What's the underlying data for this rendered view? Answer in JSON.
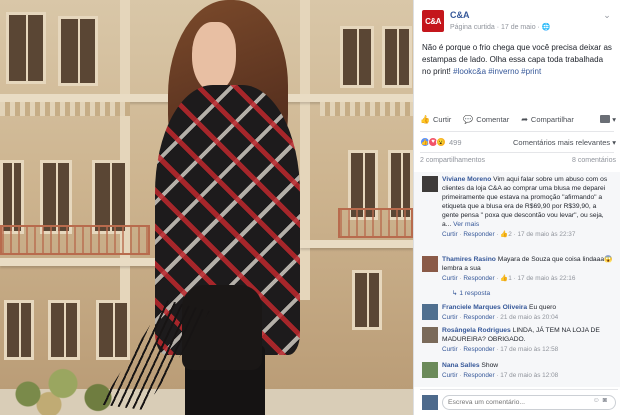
{
  "post": {
    "page_name": "C&A",
    "logo_text": "C&A",
    "subtitle": "Página curtida · 17 de maio ·",
    "text": "Não é porque o frio chega que você precisa deixar as estampas de lado. Olha essa capa toda trabalhada no print! ",
    "hashtags": "#lookc&a #inverno #print"
  },
  "actions": {
    "like": "Curtir",
    "comment": "Comentar",
    "share": "Compartilhar"
  },
  "reactions": {
    "count": "499",
    "sort": "Comentários mais relevantes ▾"
  },
  "counts": {
    "shares": "2 compartilhamentos",
    "comments": "8 comentários"
  },
  "comments": [
    {
      "name": "Viviane Moreno",
      "text": " Vim aqui falar sobre um abuso com os clientes da loja C&A ao comprar uma blusa me deparei primeiramente que estava na promoção \"afirmando\" a etiqueta que a blusa era de R$69,90 por R$39,90, a gente pensa \" poxa que descontão vou levar\", ou seja, a... ",
      "more": "Ver mais",
      "like": "Curtir",
      "reply": "Responder",
      "reacts": "2",
      "time": "17 de maio às 22:37"
    },
    {
      "name": "Thamires Rasino",
      "text": " Mayara de Souza que coisa lindaaa😱 lembra a sua",
      "like": "Curtir",
      "reply": "Responder",
      "reacts": "1",
      "time": "17 de maio às 22:16"
    },
    {
      "name": "Franciele Marques Oliveira",
      "text": " Eu quero",
      "like": "Curtir",
      "reply": "Responder",
      "time": "21 de maio às 20:04"
    },
    {
      "name": "Rosângela Rodrigues",
      "text": " LINDA, JÁ TEM NA LOJA DE MADUREIRA? OBRIGADO.",
      "like": "Curtir",
      "reply": "Responder",
      "time": "17 de maio às 12:58"
    },
    {
      "name": "Nana Salles",
      "text": " Show",
      "like": "Curtir",
      "reply": "Responder",
      "time": "17 de maio às 12:08"
    }
  ],
  "reply_link": "↳ 1 resposta",
  "composer": {
    "placeholder": "Escreva um comentário..."
  }
}
